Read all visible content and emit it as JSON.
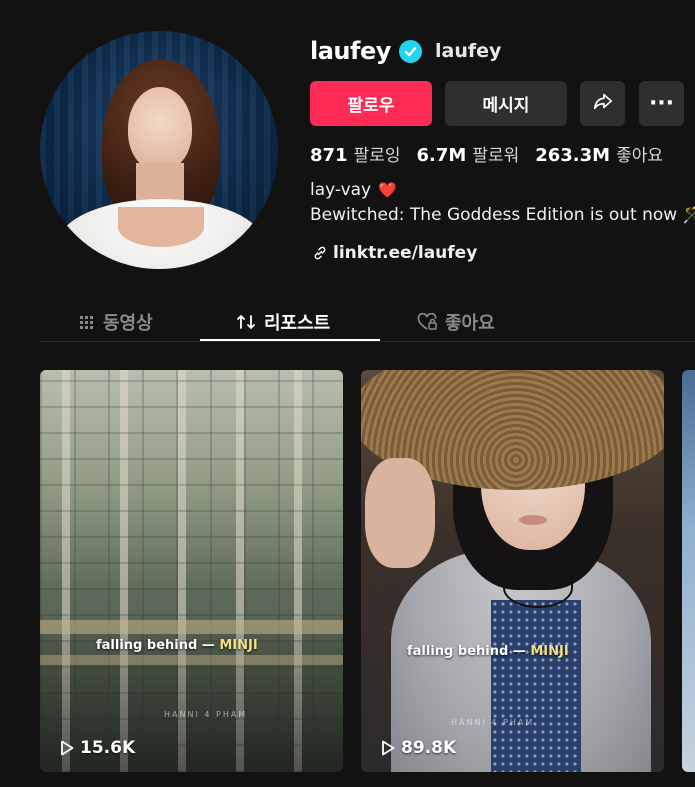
{
  "profile": {
    "username": "laufey",
    "nickname": "laufey",
    "verified": true,
    "avatar_alt": "profile photo"
  },
  "actions": {
    "follow_label": "팔로우",
    "message_label": "메시지",
    "share_icon": "share-icon",
    "more_label": "···"
  },
  "stats": {
    "following_count": "871",
    "following_label": "팔로잉",
    "followers_count": "6.7M",
    "followers_label": "팔로워",
    "likes_count": "263.3M",
    "likes_label": "좋아요"
  },
  "bio": {
    "line1": "lay-vay",
    "line1_emoji": "❤️",
    "line2": "Bewitched: The Goddess Edition is out now 🪄"
  },
  "link": {
    "text": "linktr.ee/laufey"
  },
  "tabs": [
    {
      "label": "동영상",
      "icon": "grid-icon",
      "active": false
    },
    {
      "label": "리포스트",
      "icon": "repost-icon",
      "active": true
    },
    {
      "label": "좋아요",
      "icon": "heart-lock-icon",
      "active": false
    }
  ],
  "videos": [
    {
      "caption": "falling behind — ",
      "artist": "MINJI",
      "watermark": "HANNI 4 PHAM",
      "views": "15.6K"
    },
    {
      "caption": "falling behind — ",
      "artist": "MINJI",
      "watermark": "HANNI 4 PHAM",
      "views": "89.8K"
    }
  ],
  "colors": {
    "background": "#121212",
    "follow_button": "#fe2c55",
    "secondary_button": "#2f2f2f",
    "verified_badge": "#20d5ec"
  }
}
